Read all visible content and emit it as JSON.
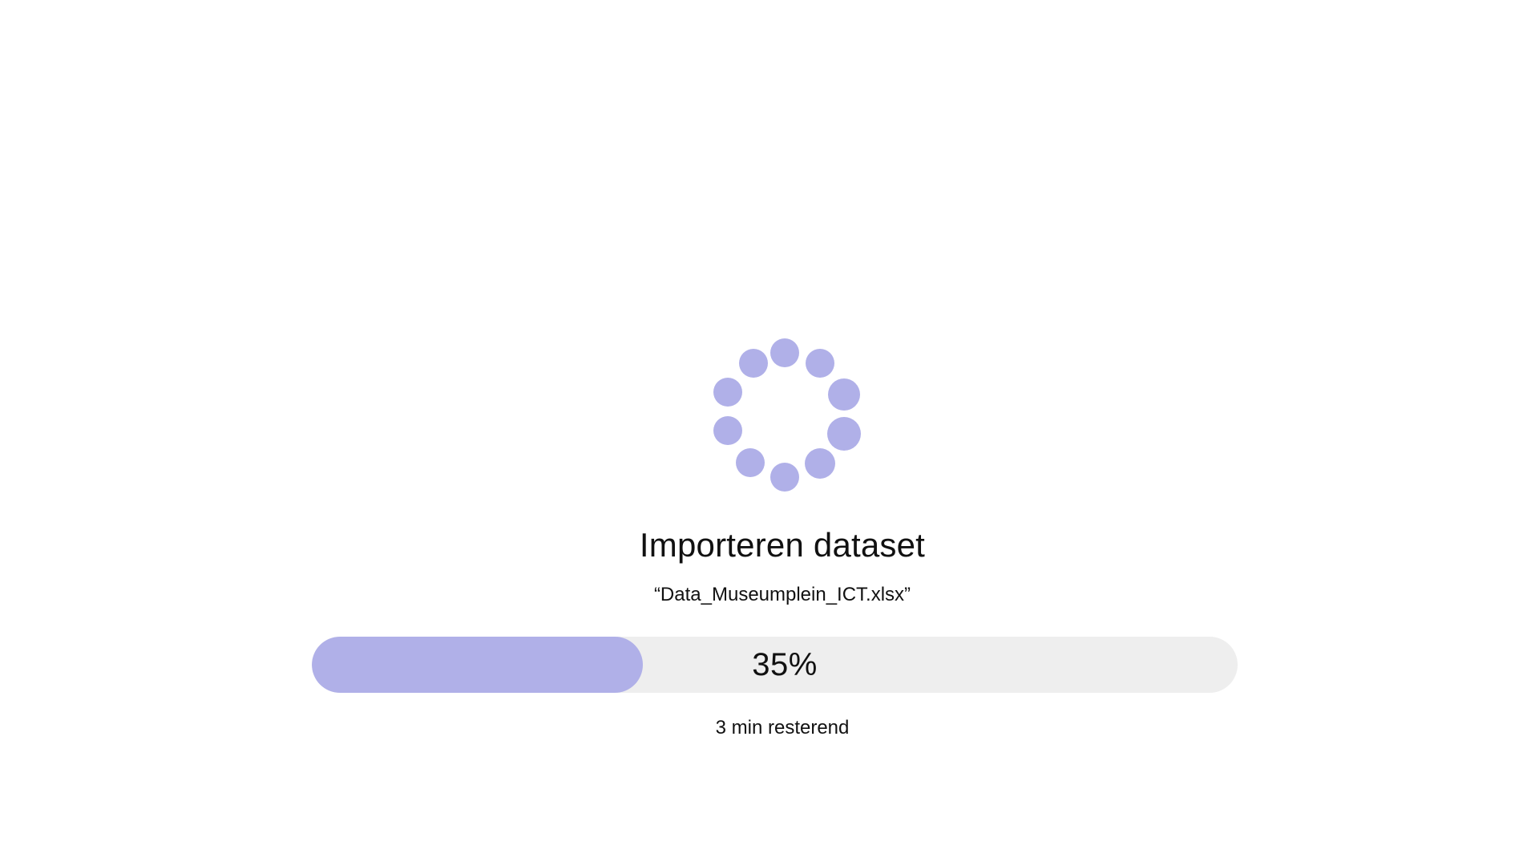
{
  "dialog": {
    "title": "Importeren dataset",
    "filename": "“Data_Museumplein_ICT.xlsx”",
    "progress": {
      "value_percent": 35,
      "label": "35%"
    },
    "remaining": "3 min resterend"
  },
  "spinner": {
    "icon": "loading-spinner-icon",
    "dot_count": 10
  },
  "colors": {
    "accent": "#b0b0e8",
    "track": "#eeeeee",
    "text": "#111111",
    "background": "#ffffff"
  }
}
